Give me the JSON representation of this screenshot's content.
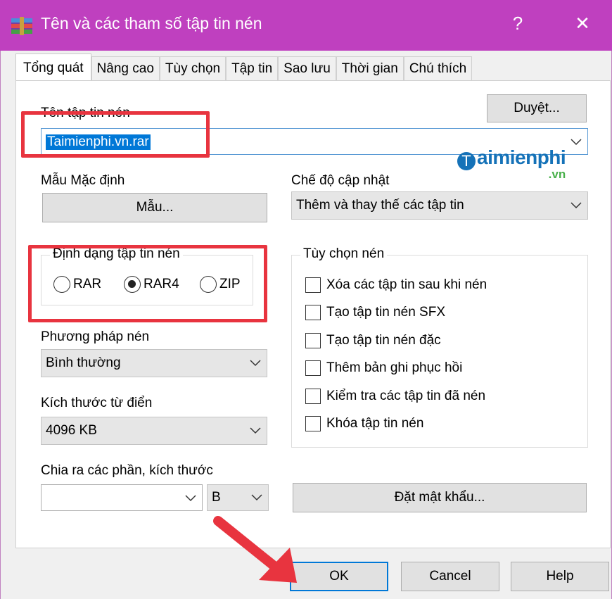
{
  "window": {
    "title": "Tên và các tham số tập tin nén",
    "help_glyph": "?",
    "close_glyph": "✕",
    "title_bar_color": "#bf40bf",
    "app_icon": "winrar-icon"
  },
  "tabs": [
    "Tổng quát",
    "Nâng cao",
    "Tùy chọn",
    "Tập tin",
    "Sao lưu",
    "Thời gian",
    "Chú thích"
  ],
  "general": {
    "archive_name_label": "Tên tập tin nén",
    "archive_name_value": "Taimienphi.vn.rar",
    "browse_button": "Duyệt...",
    "profile_label": "Mẫu Mặc định",
    "profile_button": "Mẫu...",
    "update_mode_label": "Chế độ cập nhật",
    "update_mode_value": "Thêm và thay thế các tập tin",
    "format_group": "Định dạng tập tin nén",
    "formats": [
      "RAR",
      "RAR4",
      "ZIP"
    ],
    "selected_format": "RAR4",
    "method_label": "Phương pháp nén",
    "method_value": "Bình thường",
    "dictionary_label": "Kích thước từ điển",
    "dictionary_value": "4096 KB",
    "split_label": "Chia ra các phần, kích thước",
    "split_value": "",
    "split_unit": "B",
    "options_group": "Tùy chọn nén",
    "options": [
      "Xóa các tập tin sau khi nén",
      "Tạo tập tin nén SFX",
      "Tạo tập tin nén đặc",
      "Thêm bản ghi phục hồi",
      "Kiểm tra các tập tin đã nén",
      "Khóa tập tin nén"
    ],
    "password_button": "Đặt mật khẩu..."
  },
  "footer": {
    "ok": "OK",
    "cancel": "Cancel",
    "help": "Help"
  },
  "watermark": {
    "logo_letter": "T",
    "text": "aimienphi",
    "suffix": ".vn"
  },
  "colors": {
    "highlight_box": "#e8343f",
    "selection": "#0078d7",
    "arrow": "#e8343f"
  }
}
